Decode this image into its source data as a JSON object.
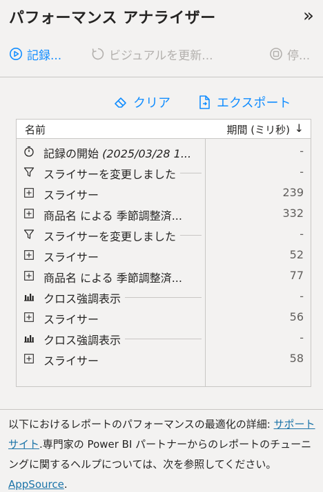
{
  "header": {
    "title": "パフォーマンス アナライザー",
    "collapse_glyph": "»"
  },
  "toolbar": {
    "record_label": "記録...",
    "refresh_label": "ビジュアルを更新...",
    "stop_label": "停..."
  },
  "actions": {
    "clear_label": "クリア",
    "export_label": "エクスポート"
  },
  "table": {
    "col_name": "名前",
    "col_duration": "期間 (ミリ秒)",
    "sort_glyph": "↓",
    "rows": [
      {
        "icon": "stopwatch-icon",
        "name": "記録の開始 ",
        "name_italic": "(2025/03/28 1...",
        "value": "-",
        "dashed": false
      },
      {
        "icon": "filter-icon",
        "name": "スライサーを変更しました",
        "name_italic": "",
        "value": "-",
        "dashed": true
      },
      {
        "icon": "expand-icon",
        "name": "スライサー",
        "name_italic": "",
        "value": "239",
        "dashed": false
      },
      {
        "icon": "expand-icon",
        "name": "商品名 による 季節調整済...",
        "name_italic": "",
        "value": "332",
        "dashed": false
      },
      {
        "icon": "filter-icon",
        "name": "スライサーを変更しました",
        "name_italic": "",
        "value": "-",
        "dashed": true
      },
      {
        "icon": "expand-icon",
        "name": "スライサー",
        "name_italic": "",
        "value": "52",
        "dashed": false
      },
      {
        "icon": "expand-icon",
        "name": "商品名 による 季節調整済...",
        "name_italic": "",
        "value": "77",
        "dashed": false
      },
      {
        "icon": "bar-chart-icon",
        "name": "クロス強調表示",
        "name_italic": "",
        "value": "-",
        "dashed": true
      },
      {
        "icon": "expand-icon",
        "name": "スライサー",
        "name_italic": "",
        "value": "56",
        "dashed": false
      },
      {
        "icon": "bar-chart-icon",
        "name": "クロス強調表示",
        "name_italic": "",
        "value": "-",
        "dashed": true
      },
      {
        "icon": "expand-icon",
        "name": "スライサー",
        "name_italic": "",
        "value": "58",
        "dashed": false
      }
    ]
  },
  "footer": {
    "text1": "以下におけるレポートのパフォーマンスの最適化の詳細: ",
    "link1": "サポート サイト",
    "text2": ".専門家の Power BI パートナーからのレポートのチューニングに関するヘルプについては、次を参照してください。 ",
    "link2": "AppSource",
    "text3": "."
  },
  "colors": {
    "accent": "#118dff",
    "disabled": "#b3b0ad",
    "background": "#f3f2f1"
  }
}
